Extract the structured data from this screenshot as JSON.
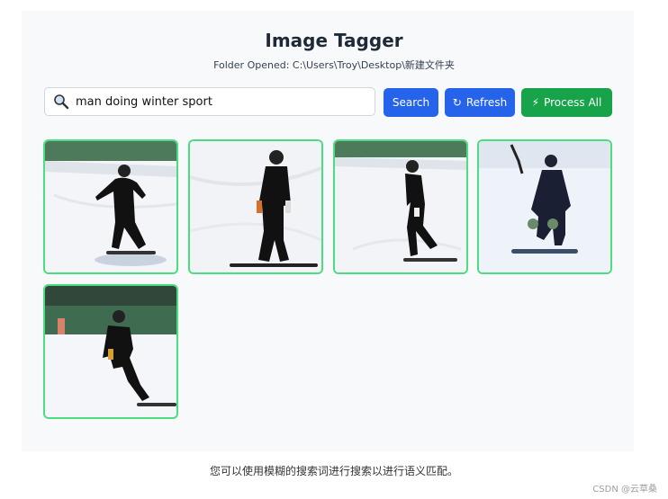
{
  "app": {
    "title": "Image Tagger",
    "folder_status": "Folder Opened: C:\\Users\\Troy\\Desktop\\新建文件夹"
  },
  "search": {
    "value": "man doing winter sport",
    "placeholder": "",
    "icon": "magnifier-icon"
  },
  "toolbar": {
    "search_label": "Search",
    "refresh_label": "Refresh",
    "refresh_icon": "↻",
    "process_label": "Process All",
    "process_icon": "⚡"
  },
  "colors": {
    "primary": "#2563eb",
    "success": "#16a34a",
    "selected_border": "#4ade80"
  },
  "results": [
    {
      "subject": "snowboarder-in-black",
      "selected": true
    },
    {
      "subject": "snowboarder-in-black",
      "selected": true
    },
    {
      "subject": "snowboarder-in-black",
      "selected": true
    },
    {
      "subject": "snowboarder-in-navy",
      "selected": true
    },
    {
      "subject": "snowboarder-in-black",
      "selected": true
    }
  ],
  "page_caption": "您可以使用模糊的搜索词进行搜索以进行语义匹配。",
  "watermark": "CSDN @云草桑"
}
